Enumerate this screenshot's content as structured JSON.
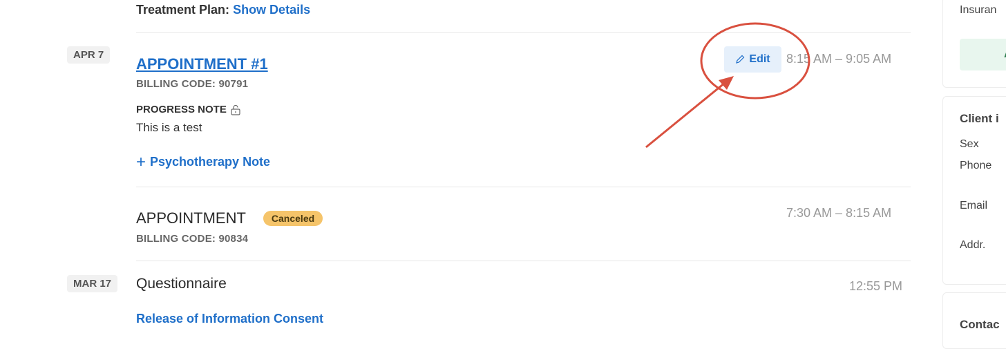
{
  "timeline": {
    "treatment_plan_label": "Treatment Plan:",
    "show_details_link": "Show Details",
    "entries": [
      {
        "date": "APR 7",
        "title": "APPOINTMENT #1",
        "billing": "BILLING CODE: 90791",
        "note_label": "PROGRESS NOTE",
        "note_text": "This is a test",
        "add_note_link": "Psychotherapy Note",
        "edit_label": "Edit",
        "time": "8:15 AM – 9:05 AM"
      },
      {
        "title": "APPOINTMENT",
        "status": "Canceled",
        "billing": "BILLING CODE: 90834",
        "time": "7:30 AM – 8:15 AM"
      },
      {
        "date": "MAR 17",
        "title": "Questionnaire",
        "time": "12:55 PM",
        "link": "Release of Information Consent"
      }
    ]
  },
  "sidebar": {
    "insurance_label": "Insuran",
    "green_button_label": "A",
    "client_info_title": "Client i",
    "fields": [
      "Sex",
      "Phone",
      "Email",
      "Addr."
    ],
    "contacts_title": "Contac"
  },
  "annotation": {
    "color": "#d9503f"
  }
}
